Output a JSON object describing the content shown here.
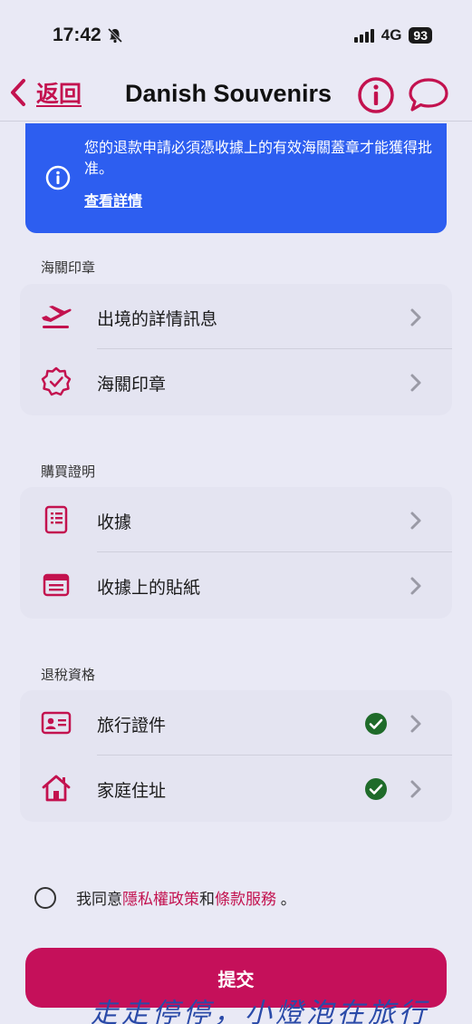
{
  "status": {
    "time": "17:42",
    "network": "4G",
    "battery": "93"
  },
  "nav": {
    "back_label": "返回",
    "title": "Danish Souvenirs"
  },
  "banner": {
    "text": "您的退款申請必須憑收據上的有效海關蓋章才能獲得批准。",
    "link": "查看詳情"
  },
  "sections": [
    {
      "title": "海關印章",
      "items": [
        {
          "label": "出境的詳情訊息",
          "icon": "airplane-departure-icon"
        },
        {
          "label": "海關印章",
          "icon": "badge-check-icon"
        }
      ]
    },
    {
      "title": "購買證明",
      "items": [
        {
          "label": "收據",
          "icon": "receipt-icon"
        },
        {
          "label": "收據上的貼紙",
          "icon": "sticker-icon"
        }
      ]
    },
    {
      "title": "退稅資格",
      "items": [
        {
          "label": "旅行證件",
          "icon": "id-card-icon",
          "completed": true
        },
        {
          "label": "家庭住址",
          "icon": "home-icon",
          "completed": true
        }
      ]
    }
  ],
  "agreement": {
    "prefix": "我同意",
    "privacy": "隱私權政策",
    "and": "和",
    "terms": "條款服務",
    "suffix": "。"
  },
  "submit_label": "提交",
  "watermark": "走走停停，小燈泡在旅行",
  "colors": {
    "accent": "#c3124f",
    "banner": "#2d5ef0",
    "check": "#1f6b2a",
    "background": "#e9e9f5"
  }
}
